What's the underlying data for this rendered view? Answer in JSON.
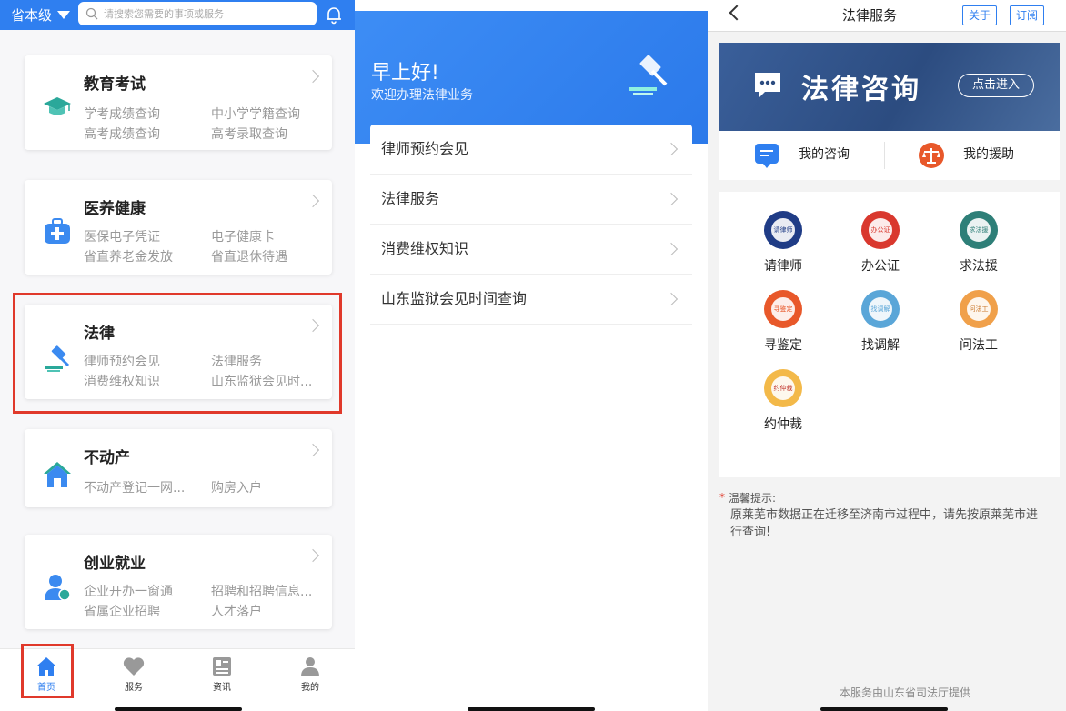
{
  "panel1": {
    "region": "省本级",
    "search_placeholder": "请搜索您需要的事项或服务",
    "cards": [
      {
        "title": "教育考试",
        "items": [
          "学考成绩查询",
          "中小学学籍查询",
          "高考成绩查询",
          "高考录取查询"
        ]
      },
      {
        "title": "医养健康",
        "items": [
          "医保电子凭证",
          "电子健康卡",
          "省直养老金发放",
          "省直退休待遇"
        ]
      },
      {
        "title": "法律",
        "items": [
          "律师预约会见",
          "法律服务",
          "消费维权知识",
          "山东监狱会见时..."
        ]
      },
      {
        "title": "不动产",
        "items": [
          "不动产登记一网...",
          "购房入户"
        ]
      },
      {
        "title": "创业就业",
        "items": [
          "企业开办一窗通",
          "招聘和招聘信息...",
          "省属企业招聘",
          "人才落户"
        ]
      }
    ],
    "tabs": [
      {
        "label": "首页"
      },
      {
        "label": "服务"
      },
      {
        "label": "资讯"
      },
      {
        "label": "我的"
      }
    ],
    "accent_color": "#2f7ff0",
    "highlight_color": "#e0392b"
  },
  "panel2": {
    "greeting": "早上好!",
    "subtitle": "欢迎办理法律业务",
    "items": [
      "律师预约会见",
      "法律服务",
      "消费维权知识",
      "山东监狱会见时间查询"
    ]
  },
  "panel3": {
    "title": "法律服务",
    "about": "关于",
    "subscribe": "订阅",
    "banner_title": "法律咨询",
    "banner_button": "点击进入",
    "quick": [
      "我的咨询",
      "我的援助"
    ],
    "services": [
      {
        "label": "请律师",
        "badge": "请律师",
        "color": "#1f3c86"
      },
      {
        "label": "办公证",
        "badge": "办公证",
        "color": "#d9382e"
      },
      {
        "label": "求法援",
        "badge": "求法援",
        "color": "#2e7f78"
      },
      {
        "label": "寻鉴定",
        "badge": "寻鉴定",
        "color": "#e8582a"
      },
      {
        "label": "找调解",
        "badge": "找调解",
        "color": "#5aa6d8"
      },
      {
        "label": "问法工",
        "badge": "问法工",
        "color": "#f0a04a"
      },
      {
        "label": "约仲裁",
        "badge": "约仲裁",
        "color": "#f3b949"
      }
    ],
    "tip_title": "温馨提示:",
    "tip_text": "原莱芜市数据正在迁移至济南市过程中，请先按原莱芜市进行查询!",
    "footer": "本服务由山东省司法厅提供"
  }
}
